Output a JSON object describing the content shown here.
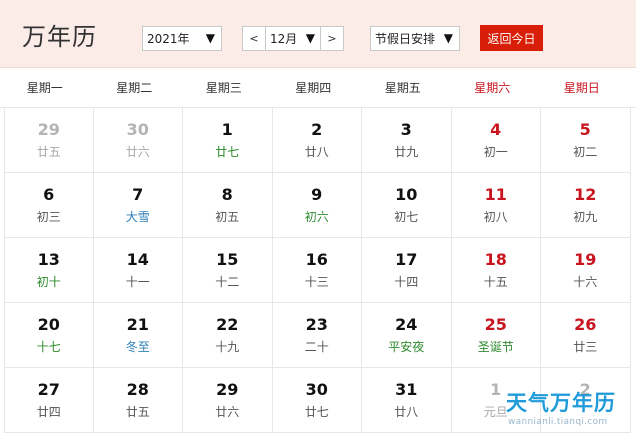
{
  "header": {
    "title": "万年历",
    "year_label": "2021年",
    "prev_label": "<",
    "month_label": "12月",
    "next_label": ">",
    "holiday_label": "节假日安排",
    "today_label": "返回今日"
  },
  "weekdays": [
    "星期一",
    "星期二",
    "星期三",
    "星期四",
    "星期五",
    "星期六",
    "星期日"
  ],
  "days": [
    {
      "day": "29",
      "lunar": "廿五",
      "other": true
    },
    {
      "day": "30",
      "lunar": "廿六",
      "other": true
    },
    {
      "day": "1",
      "lunar": "廿七",
      "tone": "green"
    },
    {
      "day": "2",
      "lunar": "廿八"
    },
    {
      "day": "3",
      "lunar": "廿九"
    },
    {
      "day": "4",
      "lunar": "初一"
    },
    {
      "day": "5",
      "lunar": "初二"
    },
    {
      "day": "6",
      "lunar": "初三"
    },
    {
      "day": "7",
      "lunar": "大雪",
      "tone": "blue"
    },
    {
      "day": "8",
      "lunar": "初五"
    },
    {
      "day": "9",
      "lunar": "初六",
      "tone": "green"
    },
    {
      "day": "10",
      "lunar": "初七"
    },
    {
      "day": "11",
      "lunar": "初八"
    },
    {
      "day": "12",
      "lunar": "初九"
    },
    {
      "day": "13",
      "lunar": "初十",
      "tone": "green"
    },
    {
      "day": "14",
      "lunar": "十一"
    },
    {
      "day": "15",
      "lunar": "十二"
    },
    {
      "day": "16",
      "lunar": "十三"
    },
    {
      "day": "17",
      "lunar": "十四"
    },
    {
      "day": "18",
      "lunar": "十五"
    },
    {
      "day": "19",
      "lunar": "十六"
    },
    {
      "day": "20",
      "lunar": "十七",
      "tone": "green"
    },
    {
      "day": "21",
      "lunar": "冬至",
      "tone": "blue"
    },
    {
      "day": "22",
      "lunar": "十九"
    },
    {
      "day": "23",
      "lunar": "二十"
    },
    {
      "day": "24",
      "lunar": "平安夜",
      "tone": "green"
    },
    {
      "day": "25",
      "lunar": "圣诞节",
      "tone": "green"
    },
    {
      "day": "26",
      "lunar": "廿三"
    },
    {
      "day": "27",
      "lunar": "廿四"
    },
    {
      "day": "28",
      "lunar": "廿五"
    },
    {
      "day": "29",
      "lunar": "廿六"
    },
    {
      "day": "30",
      "lunar": "廿七"
    },
    {
      "day": "31",
      "lunar": "廿八"
    },
    {
      "day": "1",
      "lunar": "元旦",
      "other": true
    },
    {
      "day": "2",
      "lunar": "",
      "other": true
    }
  ],
  "watermark": {
    "brand": "天气万年历",
    "url": "wannianli.tianqi.com"
  },
  "colors": {
    "accent": "#d81e06",
    "weekend": "#c8141e",
    "header_bg": "#fbece8",
    "festival_green": "#2e8b2e",
    "solar_term_blue": "#2c7fb8"
  }
}
